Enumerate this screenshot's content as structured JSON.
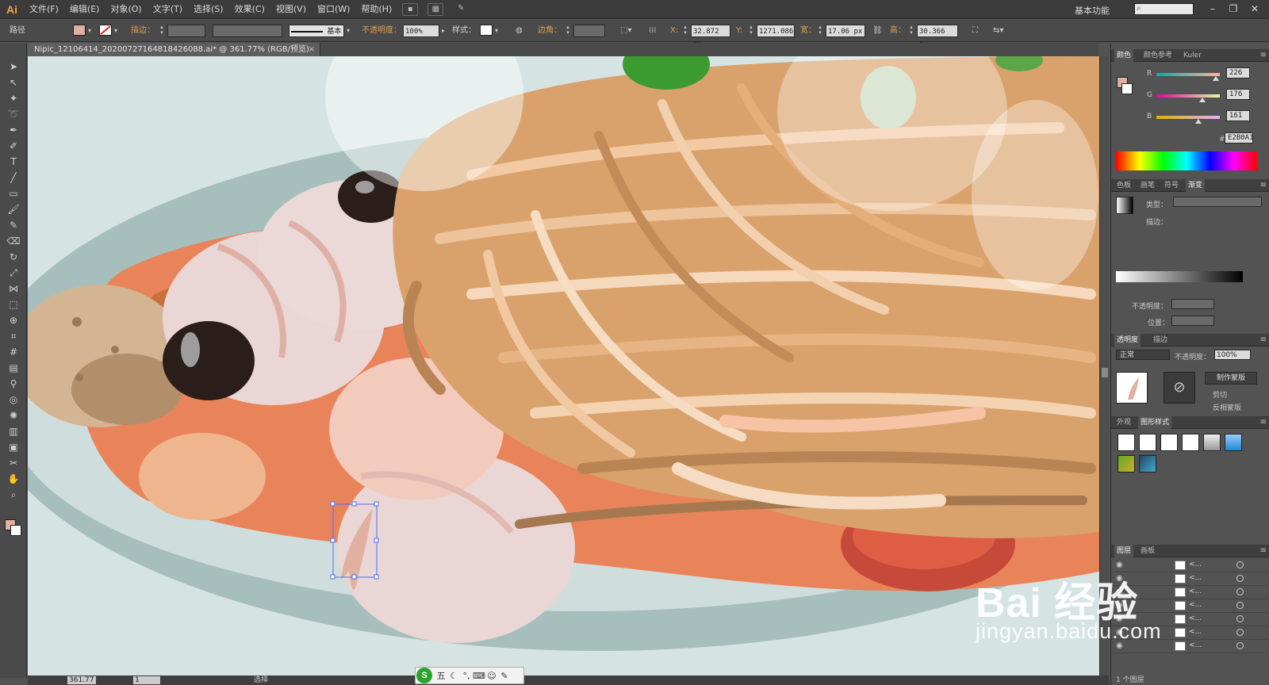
{
  "app": {
    "logo": "Ai",
    "workspace": "基本功能",
    "search_placeholder": ""
  },
  "menu": [
    "文件(F)",
    "编辑(E)",
    "对象(O)",
    "文字(T)",
    "选择(S)",
    "效果(C)",
    "视图(V)",
    "窗口(W)",
    "帮助(H)"
  ],
  "controlbar": {
    "selection_type": "路径",
    "stroke_label": "描边：",
    "stroke_profile": "基本",
    "opacity_label": "不透明度：",
    "opacity_value": "100%",
    "style_label": "样式：",
    "corner_label": "边角：",
    "x_label": "X:",
    "x_value": "32.872 px",
    "y_label": "Y:",
    "y_value": "1271.086",
    "w_label": "宽：",
    "w_value": "17.06 px",
    "h_label": "高：",
    "h_value": "30.366 px",
    "fill_color": "#e2b0a1"
  },
  "document": {
    "tab_title": "Nipic_12106414_20200727164818426088.ai* @ 361.77% (RGB/预览)",
    "close_glyph": "×"
  },
  "tools": [
    "selection-tool",
    "direct-selection-tool",
    "magic-wand-tool",
    "lasso-tool",
    "pen-tool",
    "curvature-tool",
    "type-tool",
    "line-tool",
    "rectangle-tool",
    "paintbrush-tool",
    "pencil-tool",
    "eraser-tool",
    "rotate-tool",
    "scale-tool",
    "width-tool",
    "free-transform-tool",
    "shape-builder-tool",
    "perspective-grid-tool",
    "mesh-tool",
    "gradient-tool",
    "eyedropper-tool",
    "blend-tool",
    "symbol-sprayer-tool",
    "column-graph-tool",
    "artboard-tool",
    "slice-tool",
    "hand-tool",
    "zoom-tool"
  ],
  "color_panel": {
    "tabs": [
      "颜色",
      "颜色参考",
      "Kuler"
    ],
    "r_label": "R",
    "r_value": "226",
    "g_label": "G",
    "g_value": "176",
    "b_label": "B",
    "b_value": "161",
    "hex_label": "#",
    "hex_value": "E2B0A1"
  },
  "gradient_panel": {
    "tabs": [
      "色板",
      "画笔",
      "符号",
      "渐变"
    ],
    "type_label": "类型：",
    "stroke_label": "描边：",
    "opacity_label": "不透明度：",
    "position_label": "位置："
  },
  "transparency_panel": {
    "tabs": [
      "透明度",
      "描边"
    ],
    "blend_mode": "正常",
    "opacity_label": "不透明度：",
    "opacity_value": "100%",
    "make_mask": "制作蒙版",
    "clip_label": "剪切",
    "invert_label": "反相蒙版"
  },
  "appearance_panel": {
    "tabs": [
      "外观",
      "图形样式"
    ]
  },
  "layers_panel": {
    "tabs": [
      "图层",
      "画板"
    ],
    "rows": [
      "<...",
      "<...",
      "<...",
      "<...",
      "<...",
      "<...",
      "<..."
    ],
    "footer": "1 个图层"
  },
  "statusbar": {
    "zoom": "361.77",
    "page": "1",
    "status": "选择"
  },
  "ime": {
    "logo": "S",
    "mode": "五"
  },
  "watermark": {
    "brand": "Bai 经验",
    "url": "jingyan.baidu.com"
  }
}
